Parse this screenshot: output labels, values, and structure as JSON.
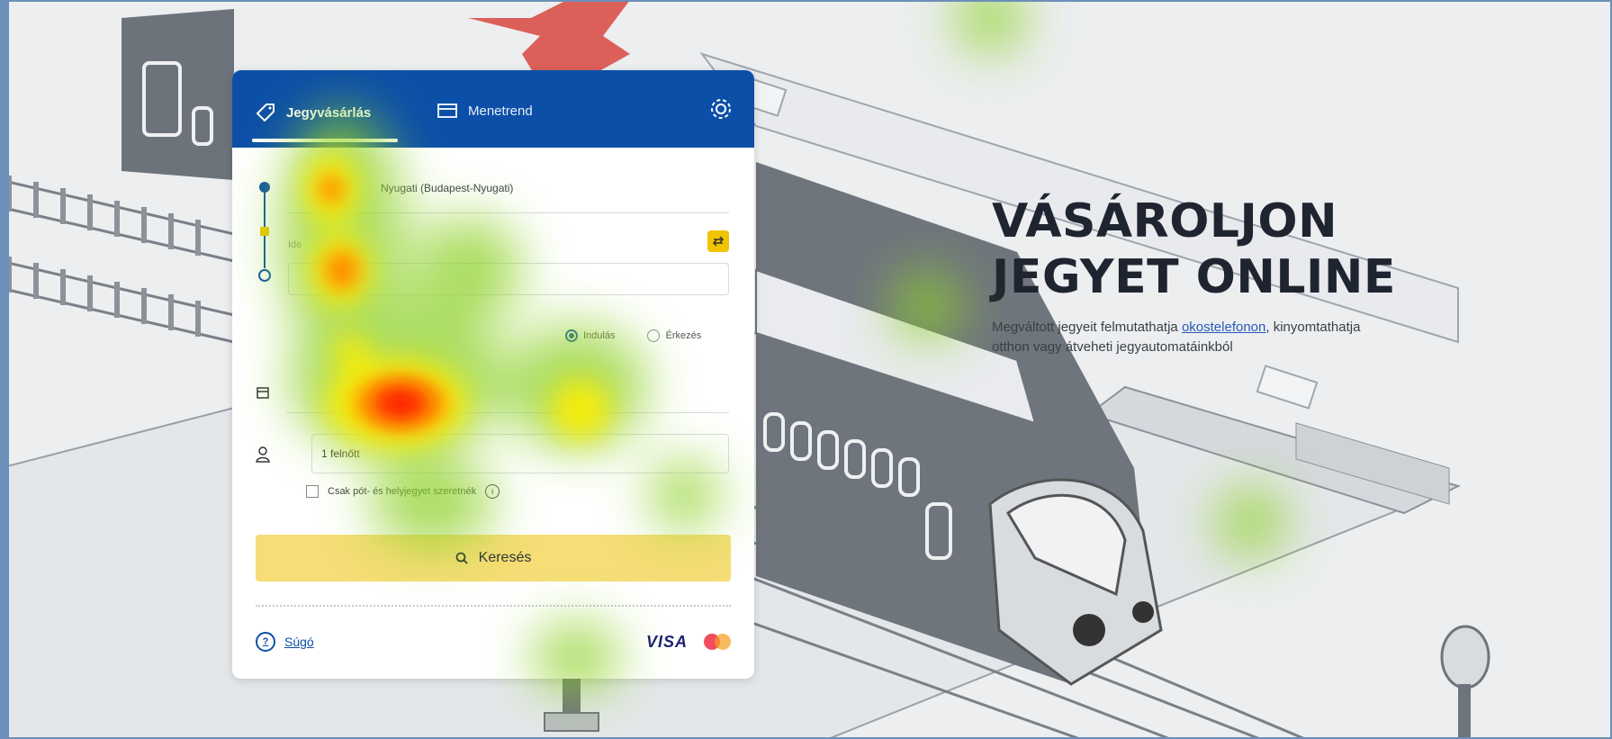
{
  "tabs": {
    "ticket_purchase": "Jegyvásárlás",
    "timetable": "Menetrend"
  },
  "form": {
    "from_value": "Nyugati (Budapest-Nyugati)",
    "to_label": "Ide",
    "trip_options": {
      "one_way": "Indulás",
      "arrival": "Érkezés"
    },
    "passenger_value": "1 felnőtt",
    "seat_only_label": "Csak pót- és helyjegyet szeretnék",
    "search_label": "Keresés"
  },
  "footer": {
    "help_label": "Súgó",
    "card_brand": "VISA"
  },
  "hero": {
    "title_line1": "VÁSÁROLJON",
    "title_line2": "JEGYET ONLINE",
    "desc_before": "Megváltott jegyeit felmutathatja ",
    "desc_link": "okostelefonon",
    "desc_after": ", kinyomtathatja otthon vagy átveheti jegyautomatáinkból"
  },
  "colors": {
    "brand_blue": "#0c4fa8",
    "search_yellow": "#f6dd76",
    "swap_yellow": "#f2c400"
  }
}
